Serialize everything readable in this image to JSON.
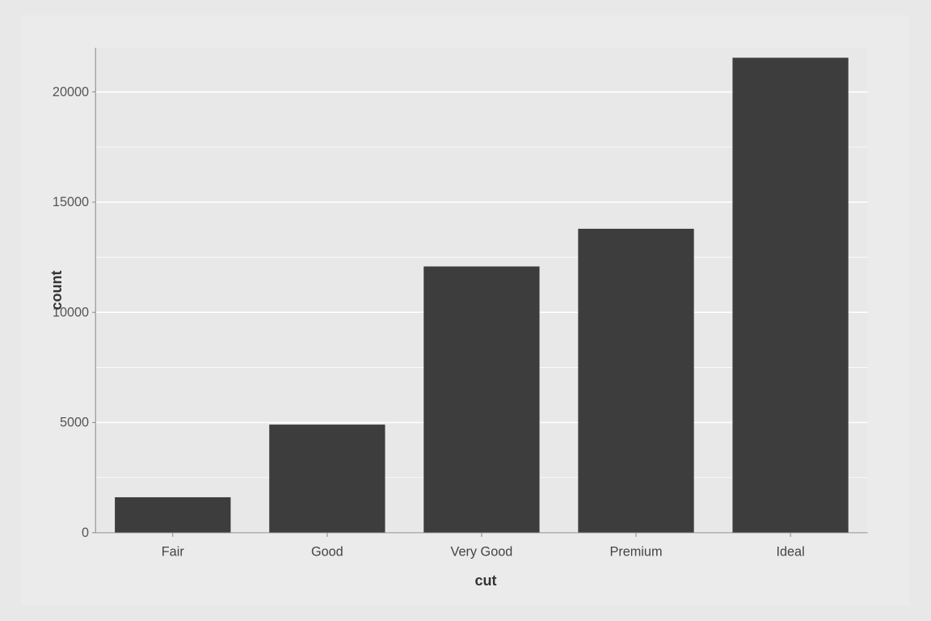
{
  "chart": {
    "title": "",
    "x_label": "cut",
    "y_label": "count",
    "background_color": "#e8e8e8",
    "plot_background_color": "#e8e8e8",
    "bar_color": "#3d3d3d",
    "grid_color": "#ffffff",
    "axis_color": "#888888",
    "bars": [
      {
        "label": "Fair",
        "value": 1610,
        "max": 22000
      },
      {
        "label": "Good",
        "value": 4906,
        "max": 22000
      },
      {
        "label": "Very Good",
        "value": 12082,
        "max": 22000
      },
      {
        "label": "Premium",
        "value": 13791,
        "max": 22000
      },
      {
        "label": "Ideal",
        "value": 21551,
        "max": 22000
      }
    ],
    "y_ticks": [
      {
        "value": 0,
        "label": "0"
      },
      {
        "value": 5000,
        "label": "5000"
      },
      {
        "value": 10000,
        "label": "10000"
      },
      {
        "value": 15000,
        "label": "15000"
      },
      {
        "value": 20000,
        "label": "20000"
      }
    ],
    "y_max": 22000
  }
}
